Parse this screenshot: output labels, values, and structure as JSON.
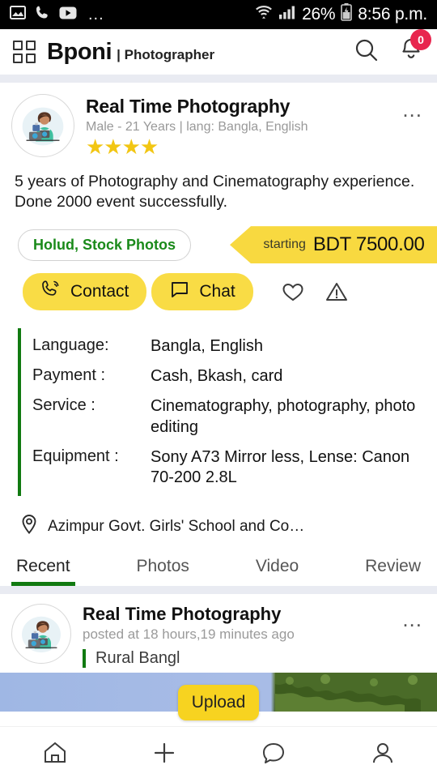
{
  "status_bar": {
    "left_icons": [
      "image-icon",
      "phone-icon",
      "youtube-icon",
      "overflow-dots"
    ],
    "dots": "...",
    "battery_percent": "26%",
    "time": "8:56 p.m.",
    "right_icons": [
      "wifi-icon",
      "signal-icon",
      "battery-icon"
    ]
  },
  "app_bar": {
    "grid_icon": "grid-icon",
    "brand": "Bponi",
    "brand_suffix": "| Photographer",
    "search_icon": "search-icon",
    "bell_icon": "bell-icon",
    "notification_count": "0"
  },
  "profile": {
    "avatar": "photographer-avatar",
    "name": "Real Time Photography",
    "meta": "Male - 21 Years | lang: Bangla, English",
    "rating_stars": 4,
    "stars_text": "★★★★",
    "overflow": "...",
    "description": "5 years of Photography and Cinematography experience. Done 2000 event successfully.",
    "category_chip": "Holud, Stock Photos",
    "price_label": "starting",
    "price_value": "BDT 7500.00"
  },
  "actions": {
    "contact_label": "Contact",
    "chat_label": "Chat",
    "favorite_icon": "heart-icon",
    "report_icon": "warning-icon"
  },
  "details": [
    {
      "label": "Language:",
      "value": "Bangla, English"
    },
    {
      "label": "Payment :",
      "value": "Cash, Bkash, card"
    },
    {
      "label": "Service :",
      "value": "Cinematography, photography, photo editing"
    },
    {
      "label": "Equipment :",
      "value": "Sony A73 Mirror less, Lense: Canon 70-200 2.8L"
    }
  ],
  "location": {
    "icon": "location-pin-icon",
    "text": "Azimpur Govt. Girls' School and Co…"
  },
  "tabs": [
    {
      "label": "Recent",
      "active": true
    },
    {
      "label": "Photos",
      "active": false
    },
    {
      "label": "Video",
      "active": false
    },
    {
      "label": "Review",
      "active": false
    }
  ],
  "post": {
    "avatar": "photographer-avatar",
    "name": "Real Time Photography",
    "time": "posted at 18 hours,19 minutes ago",
    "title": "Rural Bangl",
    "overflow": "...",
    "image": "rural-landscape-photo"
  },
  "upload_button": {
    "label": "Upload"
  },
  "bottom_nav": [
    {
      "icon": "home-icon",
      "name": "nav-home"
    },
    {
      "icon": "plus-icon",
      "name": "nav-add"
    },
    {
      "icon": "chat-bubble-icon",
      "name": "nav-messages"
    },
    {
      "icon": "person-icon",
      "name": "nav-profile"
    }
  ],
  "colors": {
    "accent_yellow": "#F9DC45",
    "ribbon_yellow": "#F8D940",
    "green": "#117A11",
    "badge_red": "#E8254E",
    "star_gold": "#F2C613"
  }
}
